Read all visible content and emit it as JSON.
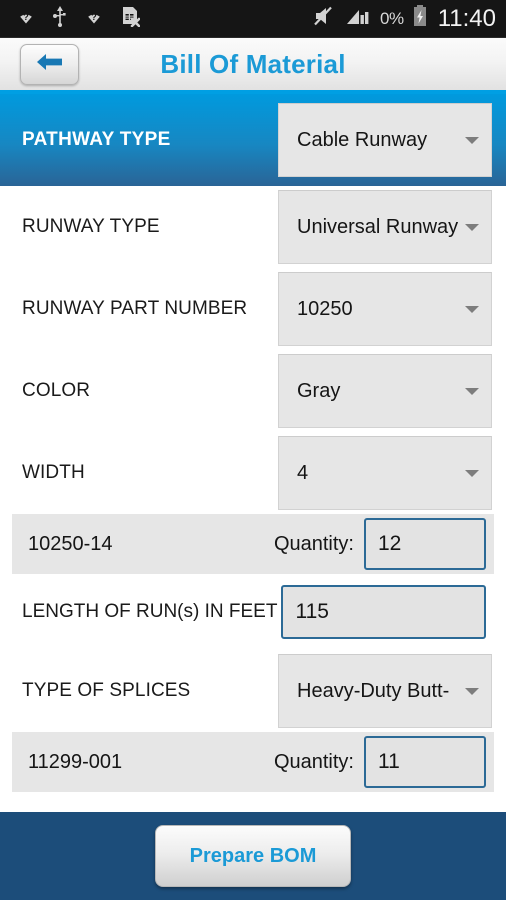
{
  "statusbar": {
    "icons_left": [
      "wifi-no-internet-icon",
      "usb-icon",
      "wifi-no-internet-icon",
      "sim-card-error-icon"
    ],
    "icons_right": [
      "volume-mute-icon",
      "signal-bars-icon",
      "battery-charging-icon"
    ],
    "battery_percent": "0%",
    "time": "11:40"
  },
  "titlebar": {
    "back_icon": "back-arrow-icon",
    "title": "Bill Of Material",
    "accent_color": "#009fe3",
    "title_color": "#1b9ad6"
  },
  "pathway": {
    "label": "PATHWAY TYPE",
    "value": "Cable Runway",
    "caret_icon": "chevron-down-icon"
  },
  "form": {
    "rows": [
      {
        "label": "RUNWAY TYPE",
        "value": "Universal Runway"
      },
      {
        "label": "RUNWAY PART NUMBER",
        "value": "10250"
      },
      {
        "label": "COLOR",
        "value": "Gray"
      },
      {
        "label": "WIDTH",
        "value": "4"
      }
    ],
    "quantity_1": {
      "part": "10250-14",
      "qty_label": "Quantity:",
      "qty_value": "12"
    },
    "length": {
      "label": "LENGTH OF RUN(s) IN FEET",
      "value": "115"
    },
    "splices": {
      "label": "TYPE OF SPLICES",
      "value": "Heavy-Duty Butt-"
    },
    "quantity_2": {
      "part": "11299-001",
      "qty_label": "Quantity:",
      "qty_value": "11"
    }
  },
  "footer": {
    "button_label": "Prepare BOM",
    "background_color": "#1c4d7a"
  }
}
